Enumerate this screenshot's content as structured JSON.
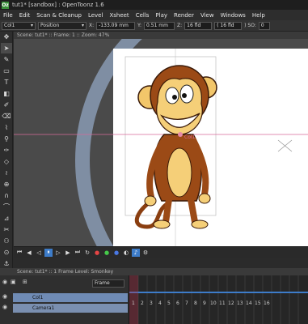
{
  "window": {
    "title": "tut1* [sandbox] : OpenToonz 1.6",
    "app_icon": "Oz"
  },
  "menu": [
    "File",
    "Edit",
    "Scan & Cleanup",
    "Level",
    "Xsheet",
    "Cells",
    "Play",
    "Render",
    "View",
    "Windows",
    "Help"
  ],
  "tool_options": {
    "column": "Col1",
    "mode": "Position",
    "x_label": "X:",
    "x_value": "-133.09 mm",
    "y_label": "Y:",
    "y_value": "0.51 mm",
    "z_label": "Z:",
    "z_value": "16 fld",
    "zfld_value": "( 16 fld",
    "so_label": ") SO:",
    "so_value": "0"
  },
  "viewer": {
    "header": "Scene: tut1*  ::  Frame: 1  ::  Zoom: 47%",
    "level_marker": "Col1"
  },
  "xsheet": {
    "header": "Scene: tut1*  ::  1 Frame  Level: Smonkey",
    "frame_dropdown": "Frame",
    "columns": [
      {
        "name": "Col1"
      },
      {
        "name": "Camera1"
      }
    ],
    "frame_numbers": [
      "1",
      "2",
      "3",
      "4",
      "5",
      "6",
      "7",
      "8",
      "9",
      "10",
      "11",
      "12",
      "13",
      "14",
      "15",
      "16"
    ]
  },
  "colors": {
    "canvas_white": "#ffffff",
    "gray_bg": "#4a4a4a",
    "ring": "#7f8ea3",
    "highlight_blue": "#3d7cc9",
    "pink_guide": "#d86a9a"
  },
  "toolbar_icons": [
    "animate-icon",
    "selection-icon",
    "brush-icon",
    "geometric-icon",
    "type-icon",
    "fill-icon",
    "paint-brush-icon",
    "eraser-icon",
    "tape-icon",
    "style-picker-icon",
    "rgb-picker-icon",
    "control-point-icon",
    "pinch-icon",
    "pump-icon",
    "magnet-icon",
    "bender-icon",
    "iron-icon",
    "cutter-icon",
    "skeleton-icon",
    "tracker-icon",
    "hook-icon",
    "plastic-icon",
    "zoom-icon",
    "rotate-icon",
    "hand-icon"
  ]
}
